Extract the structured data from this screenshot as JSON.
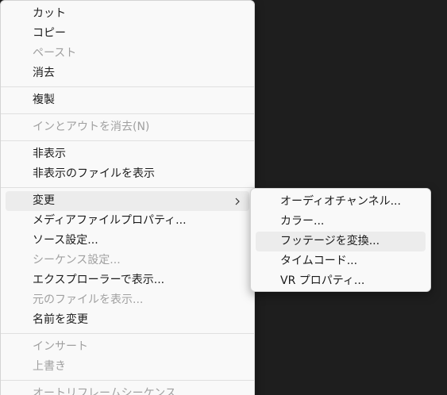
{
  "context_menu": {
    "groups": [
      [
        {
          "label": "カット",
          "disabled": false
        },
        {
          "label": "コピー",
          "disabled": false
        },
        {
          "label": "ペースト",
          "disabled": true
        },
        {
          "label": "消去",
          "disabled": false
        }
      ],
      [
        {
          "label": "複製",
          "disabled": false
        }
      ],
      [
        {
          "label": "インとアウトを消去(N)",
          "disabled": true
        }
      ],
      [
        {
          "label": "非表示",
          "disabled": false
        },
        {
          "label": "非表示のファイルを表示",
          "disabled": false
        }
      ],
      [
        {
          "label": "変更",
          "disabled": false,
          "submenu": true,
          "highlighted": true
        },
        {
          "label": "メディアファイルプロパティ...",
          "disabled": false
        },
        {
          "label": "ソース設定...",
          "disabled": false
        },
        {
          "label": "シーケンス設定...",
          "disabled": true
        },
        {
          "label": "エクスプローラーで表示...",
          "disabled": false
        },
        {
          "label": "元のファイルを表示...",
          "disabled": true
        },
        {
          "label": "名前を変更",
          "disabled": false
        }
      ],
      [
        {
          "label": "インサート",
          "disabled": true
        },
        {
          "label": "上書き",
          "disabled": true
        }
      ],
      [
        {
          "label": "オートリフレームシーケンス...",
          "disabled": true
        }
      ]
    ]
  },
  "submenu": {
    "parent": "変更",
    "items": [
      {
        "label": "オーディオチャンネル...",
        "disabled": false
      },
      {
        "label": "カラー...",
        "disabled": false
      },
      {
        "label": "フッテージを変換...",
        "disabled": false,
        "highlighted": true
      },
      {
        "label": "タイムコード...",
        "disabled": false
      },
      {
        "label": "VR プロパティ...",
        "disabled": false
      }
    ]
  },
  "icons": {
    "submenu_arrow": "chevron-right-icon"
  },
  "colors": {
    "background": "#1e1e1e",
    "menu_background": "#f9f9f9",
    "text": "#1b1b1b",
    "disabled_text": "#a0a0a0",
    "highlight": "#ececec",
    "separator": "#e0e0e0"
  }
}
